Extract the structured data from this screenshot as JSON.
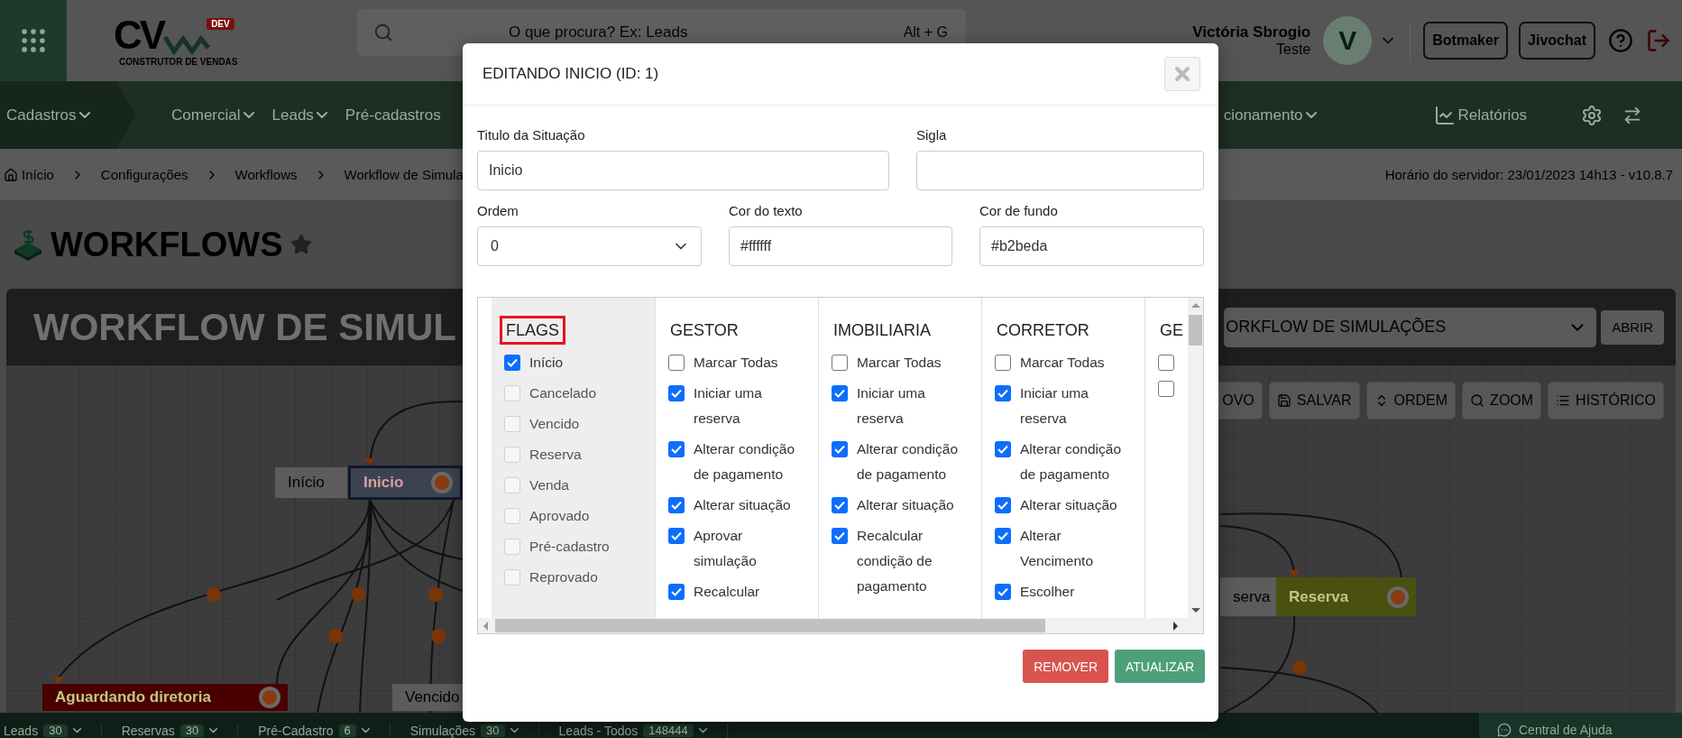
{
  "header": {
    "logo": {
      "mark": "CV",
      "badge": "DEV",
      "tagline": "CONSTRUTOR DE VENDAS"
    },
    "search": {
      "placeholder": "O que procura? Ex: Leads",
      "shortcut": "Alt + G"
    },
    "user": {
      "name": "Victória Sbrogio",
      "subtitle": "Teste",
      "avatar": "V"
    },
    "buttons": [
      "Botmaker",
      "Jivochat"
    ]
  },
  "nav": {
    "items": [
      {
        "label": "Cadastros",
        "kind": "section"
      },
      {
        "label": "Comercial",
        "kind": "menu"
      },
      {
        "label": "Leads",
        "kind": "menu"
      },
      {
        "label": "Pré-cadastros",
        "kind": "plain"
      }
    ],
    "right_menu": "cionamento",
    "reports": "Relatórios"
  },
  "breadcrumb": [
    "Início",
    "Configurações",
    "Workflows",
    "Workflow de Simula"
  ],
  "server_time": "Horário do servidor: 23/01/2023 14h13 - v10.8.7",
  "page_title": "WORKFLOWS",
  "workflow": {
    "title": "WORKFLOW DE SIMUL",
    "select_value": "ORKFLOW DE SIMULAÇÕES",
    "open_button": "ABRIR"
  },
  "toolbar": [
    "OVO",
    "SALVAR",
    "ORDEM",
    "ZOOM",
    "HISTÓRICO"
  ],
  "nodes": [
    {
      "label": "Início",
      "kind": "tag",
      "selected": false
    },
    {
      "label": "Inicio",
      "kind": "state",
      "color": "#3c4250",
      "selected": true
    },
    {
      "label": "Aguardando diretoria",
      "kind": "state",
      "color": "#4a0000",
      "selected": false
    },
    {
      "label": "Vencido",
      "kind": "tag",
      "selected": false
    },
    {
      "label": "serva",
      "kind": "tag",
      "selected": false
    },
    {
      "label": "Reserva",
      "kind": "state",
      "color": "#4a5010",
      "selected": false
    }
  ],
  "bottom_bar": {
    "tabs": [
      {
        "label": "Leads",
        "count": "30"
      },
      {
        "label": "Reservas",
        "count": "30"
      },
      {
        "label": "Pré-Cadastro",
        "count": "6"
      },
      {
        "label": "Simulações",
        "count": "30"
      },
      {
        "label": "Leads - Todos",
        "count": "148444"
      }
    ],
    "help": "Central de Ajuda"
  },
  "modal": {
    "title": "EDITANDO INICIO (ID: 1)",
    "fields": [
      {
        "label": "Titulo da Situação",
        "value": "Inicio",
        "kind": "text"
      },
      {
        "label": "Sigla",
        "kind": "text"
      },
      {
        "label": "Ordem",
        "value": "0",
        "kind": "select"
      },
      {
        "label": "Cor do texto",
        "value": "#ffffff",
        "kind": "text"
      },
      {
        "label": "Cor de fundo",
        "value": "#b2beda",
        "kind": "text"
      }
    ],
    "flags": {
      "title": "FLAGS",
      "highlighted": true,
      "items": [
        {
          "label": "Início",
          "checked": true,
          "disabled": false
        },
        {
          "label": "Cancelado",
          "checked": false,
          "disabled": true
        },
        {
          "label": "Vencido",
          "checked": false,
          "disabled": true
        },
        {
          "label": "Reserva",
          "checked": false,
          "disabled": true
        },
        {
          "label": "Venda",
          "checked": false,
          "disabled": true
        },
        {
          "label": "Aprovado",
          "checked": false,
          "disabled": true
        },
        {
          "label": "Pré-cadastro",
          "checked": false,
          "disabled": true
        },
        {
          "label": "Reprovado",
          "checked": false,
          "disabled": true
        }
      ]
    },
    "groups": [
      {
        "title": "GESTOR",
        "items": [
          {
            "label": "Marcar Todas",
            "checked": false
          },
          {
            "label": "Iniciar uma reserva",
            "checked": true
          },
          {
            "label": "Alterar condição de pagamento",
            "checked": true
          },
          {
            "label": "Alterar situação",
            "checked": true
          },
          {
            "label": "Aprovar simulação",
            "checked": true
          },
          {
            "label": "Recalcular",
            "checked": true
          }
        ]
      },
      {
        "title": "IMOBILIARIA",
        "items": [
          {
            "label": "Marcar Todas",
            "checked": false
          },
          {
            "label": "Iniciar uma reserva",
            "checked": true
          },
          {
            "label": "Alterar condição de pagamento",
            "checked": true
          },
          {
            "label": "Alterar situação",
            "checked": true
          },
          {
            "label": "Recalcular condição de pagamento",
            "checked": true
          }
        ]
      },
      {
        "title": "CORRETOR",
        "items": [
          {
            "label": "Marcar Todas",
            "checked": false
          },
          {
            "label": "Iniciar uma reserva",
            "checked": true
          },
          {
            "label": "Alterar condição de pagamento",
            "checked": true
          },
          {
            "label": "Alterar situação",
            "checked": true
          },
          {
            "label": "Alterar Vencimento",
            "checked": true
          },
          {
            "label": "Escolher",
            "checked": true
          }
        ]
      },
      {
        "title": "GE",
        "items": [
          {
            "checked": false
          },
          {
            "checked": false
          }
        ]
      }
    ],
    "buttons": [
      {
        "label": "REMOVER",
        "kind": "danger"
      },
      {
        "label": "ATUALIZAR",
        "kind": "primary"
      }
    ]
  }
}
